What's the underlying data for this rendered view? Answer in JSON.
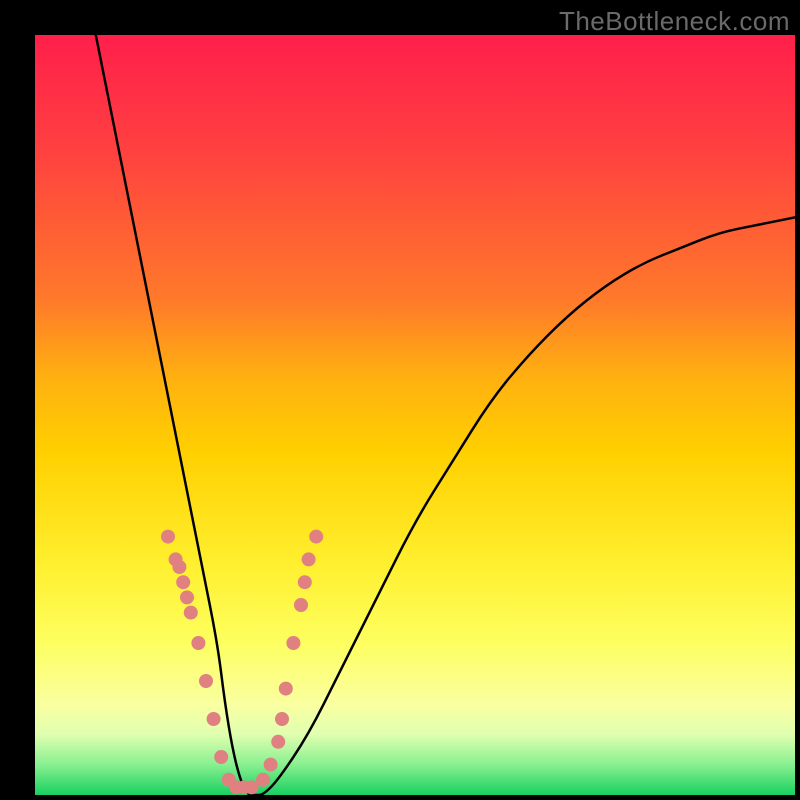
{
  "watermark": "TheBottleneck.com",
  "chart_data": {
    "type": "line",
    "title": "",
    "xlabel": "",
    "ylabel": "",
    "xlim": [
      0,
      100
    ],
    "ylim": [
      0,
      100
    ],
    "series": [
      {
        "name": "curve",
        "x": [
          8,
          10,
          12,
          14,
          16,
          18,
          20,
          22,
          24,
          25,
          26,
          27,
          28,
          29,
          30,
          32,
          36,
          40,
          45,
          50,
          55,
          60,
          65,
          70,
          75,
          80,
          85,
          90,
          95,
          100
        ],
        "values": [
          100,
          90,
          80,
          70,
          60,
          50,
          40,
          30,
          20,
          12,
          6,
          2,
          0,
          0,
          0,
          2,
          8,
          16,
          26,
          36,
          44,
          52,
          58,
          63,
          67,
          70,
          72,
          74,
          75,
          76
        ]
      }
    ],
    "markers": {
      "name": "dots",
      "color": "#e08080",
      "x": [
        17.5,
        18.5,
        19.0,
        19.5,
        20.0,
        20.5,
        21.5,
        22.5,
        23.5,
        24.5,
        25.5,
        26.5,
        27.5,
        28.5,
        30.0,
        31.0,
        32.0,
        32.5,
        33.0,
        34.0,
        35.0,
        35.5,
        36.0,
        37.0
      ],
      "values": [
        34,
        31,
        30,
        28,
        26,
        24,
        20,
        15,
        10,
        5,
        2,
        1,
        1,
        1,
        2,
        4,
        7,
        10,
        14,
        20,
        25,
        28,
        31,
        34
      ]
    }
  }
}
